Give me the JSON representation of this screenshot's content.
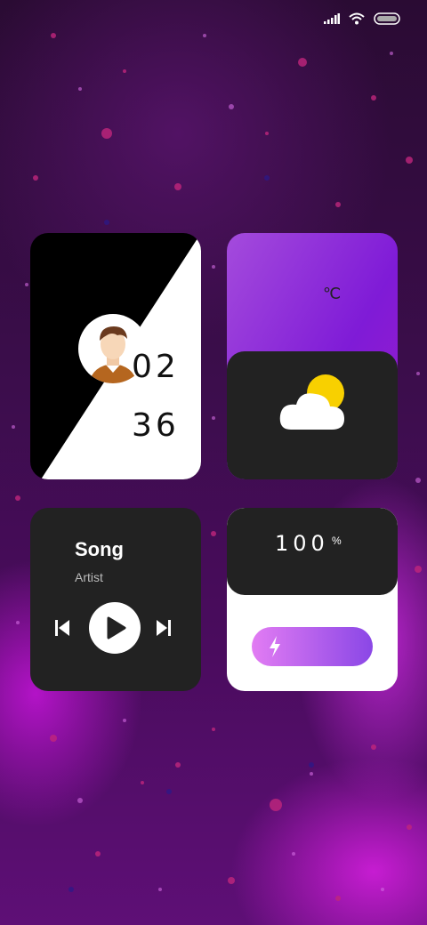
{
  "status_bar": {
    "icons": [
      "signal-icon",
      "wifi-icon",
      "battery-icon"
    ]
  },
  "clock": {
    "hours": "02",
    "minutes": "36",
    "avatar": "avatar"
  },
  "weather": {
    "unit": "℃",
    "icon": "partly-cloudy-icon"
  },
  "music": {
    "title": "Song",
    "artist": "Artist",
    "controls": [
      "previous-icon",
      "play-icon",
      "next-icon"
    ]
  },
  "battery": {
    "percent": "100",
    "percent_symbol": "%",
    "level": 1.0,
    "icon": "lightning-bolt-icon"
  },
  "colors": {
    "card_dark": "#222222",
    "accent_purple": "#8a47e6",
    "accent_pink": "#e27cf3",
    "sun": "#f8d000"
  }
}
